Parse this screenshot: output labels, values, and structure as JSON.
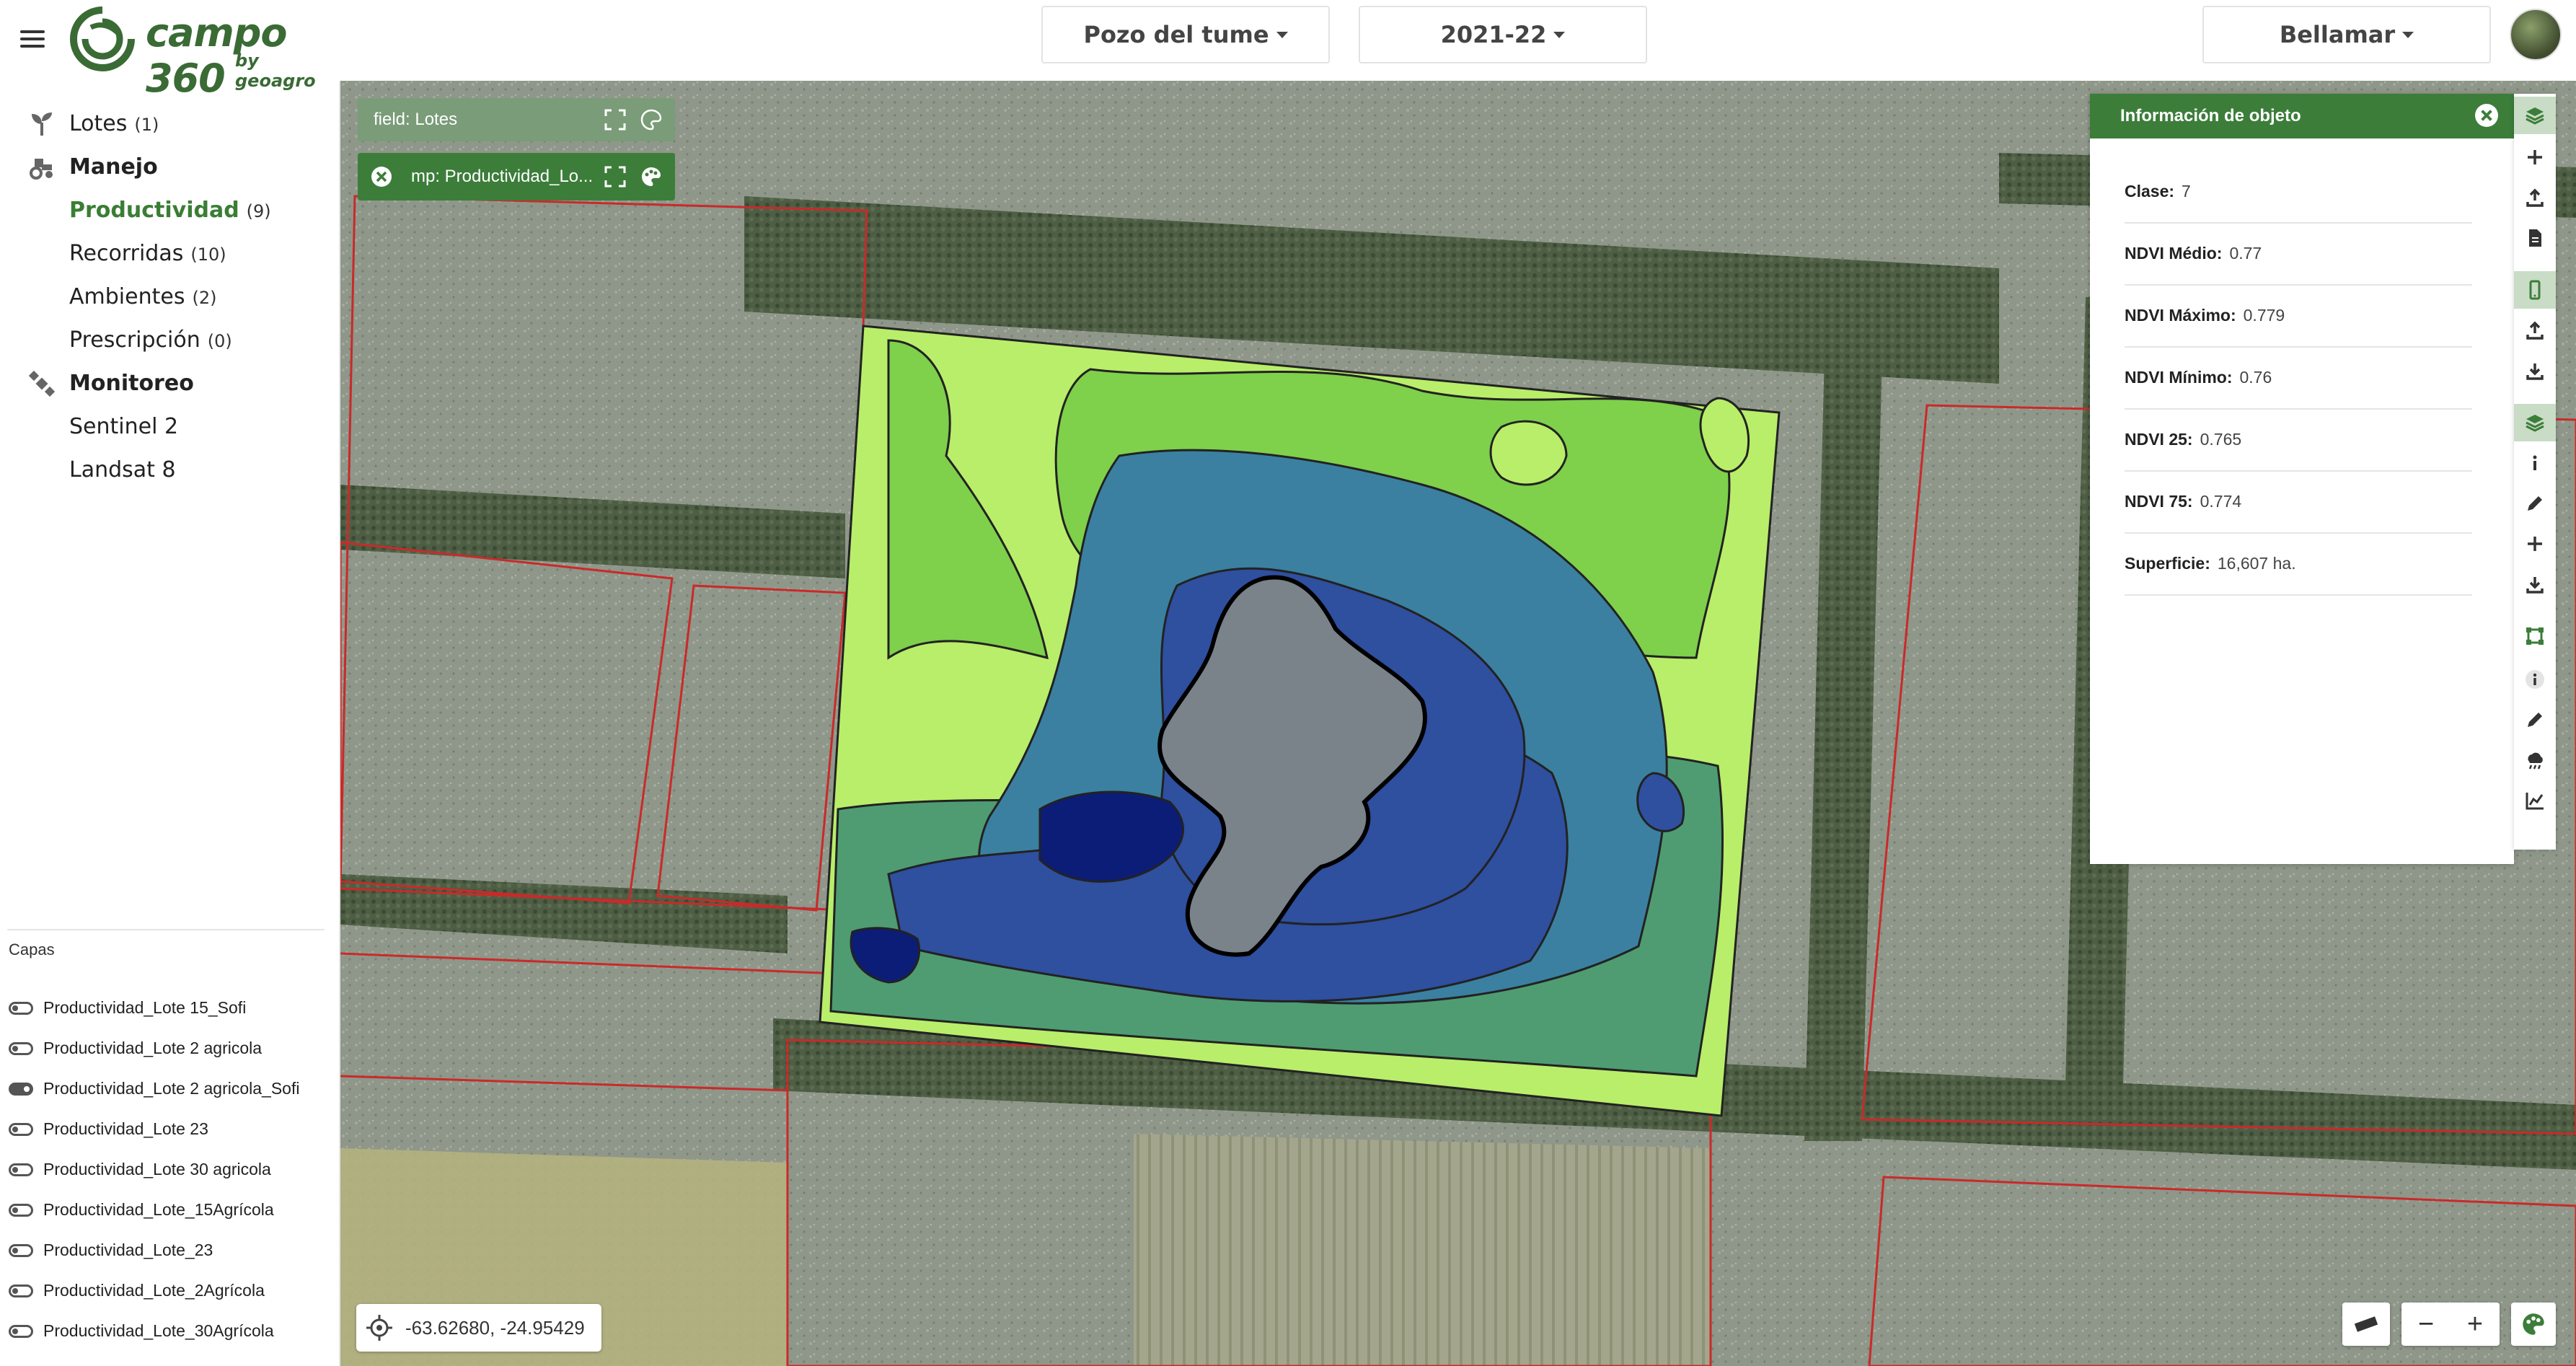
{
  "header": {
    "logo_text": "campo 360",
    "logo_sub": "by geoagro",
    "field_selector": "Pozo del tume",
    "season_selector": "2021-22",
    "account_selector": "Bellamar"
  },
  "sidebar": {
    "items": [
      {
        "label": "Lotes",
        "count": "(1)",
        "icon": "sprout-icon"
      },
      {
        "label": "Manejo",
        "icon": "tractor-icon"
      },
      {
        "label": "Productividad",
        "count": "(9)"
      },
      {
        "label": "Recorridas",
        "count": "(10)"
      },
      {
        "label": "Ambientes",
        "count": "(2)"
      },
      {
        "label": "Prescripción",
        "count": "(0)"
      },
      {
        "label": "Monitoreo",
        "icon": "satellite-icon"
      },
      {
        "label": "Sentinel 2"
      },
      {
        "label": "Landsat 8"
      }
    ],
    "capas_title": "Capas",
    "layers": [
      {
        "name": "Productividad_Lote 15_Sofi",
        "visible": false
      },
      {
        "name": "Productividad_Lote 2 agricola",
        "visible": false
      },
      {
        "name": "Productividad_Lote 2 agricola_Sofi",
        "visible": true
      },
      {
        "name": "Productividad_Lote 23",
        "visible": false
      },
      {
        "name": "Productividad_Lote 30 agricola",
        "visible": false
      },
      {
        "name": "Productividad_Lote_15Agrícola",
        "visible": false
      },
      {
        "name": "Productividad_Lote_23",
        "visible": false
      },
      {
        "name": "Productividad_Lote_2Agrícola",
        "visible": false
      },
      {
        "name": "Productividad_Lote_30Agrícola",
        "visible": false
      }
    ]
  },
  "map": {
    "field_layer_label": "field: Lotes",
    "mp_layer_label": "mp: Productividad_Lo...",
    "coordinates": "-63.62680, -24.95429",
    "zoom_out": "−",
    "zoom_in": "+"
  },
  "info_panel": {
    "title": "Información de objeto",
    "rows": [
      {
        "label": "Clase:",
        "value": "7"
      },
      {
        "label": "NDVI Médio:",
        "value": "0.77"
      },
      {
        "label": "NDVI Máximo:",
        "value": "0.779"
      },
      {
        "label": "NDVI Mínimo:",
        "value": "0.76"
      },
      {
        "label": "NDVI 25:",
        "value": "0.765"
      },
      {
        "label": "NDVI 75:",
        "value": "0.774"
      },
      {
        "label": "Superficie:",
        "value": "16,607 ha."
      }
    ]
  },
  "colors": {
    "brand": "#3c7d3a",
    "zone_light": "#b9ee6a",
    "zone_green": "#7fd04b",
    "zone_mid": "#4f9c72",
    "zone_teal": "#3b80a0",
    "zone_blue": "#2f4f9f",
    "zone_dark": "#0c1d78"
  }
}
